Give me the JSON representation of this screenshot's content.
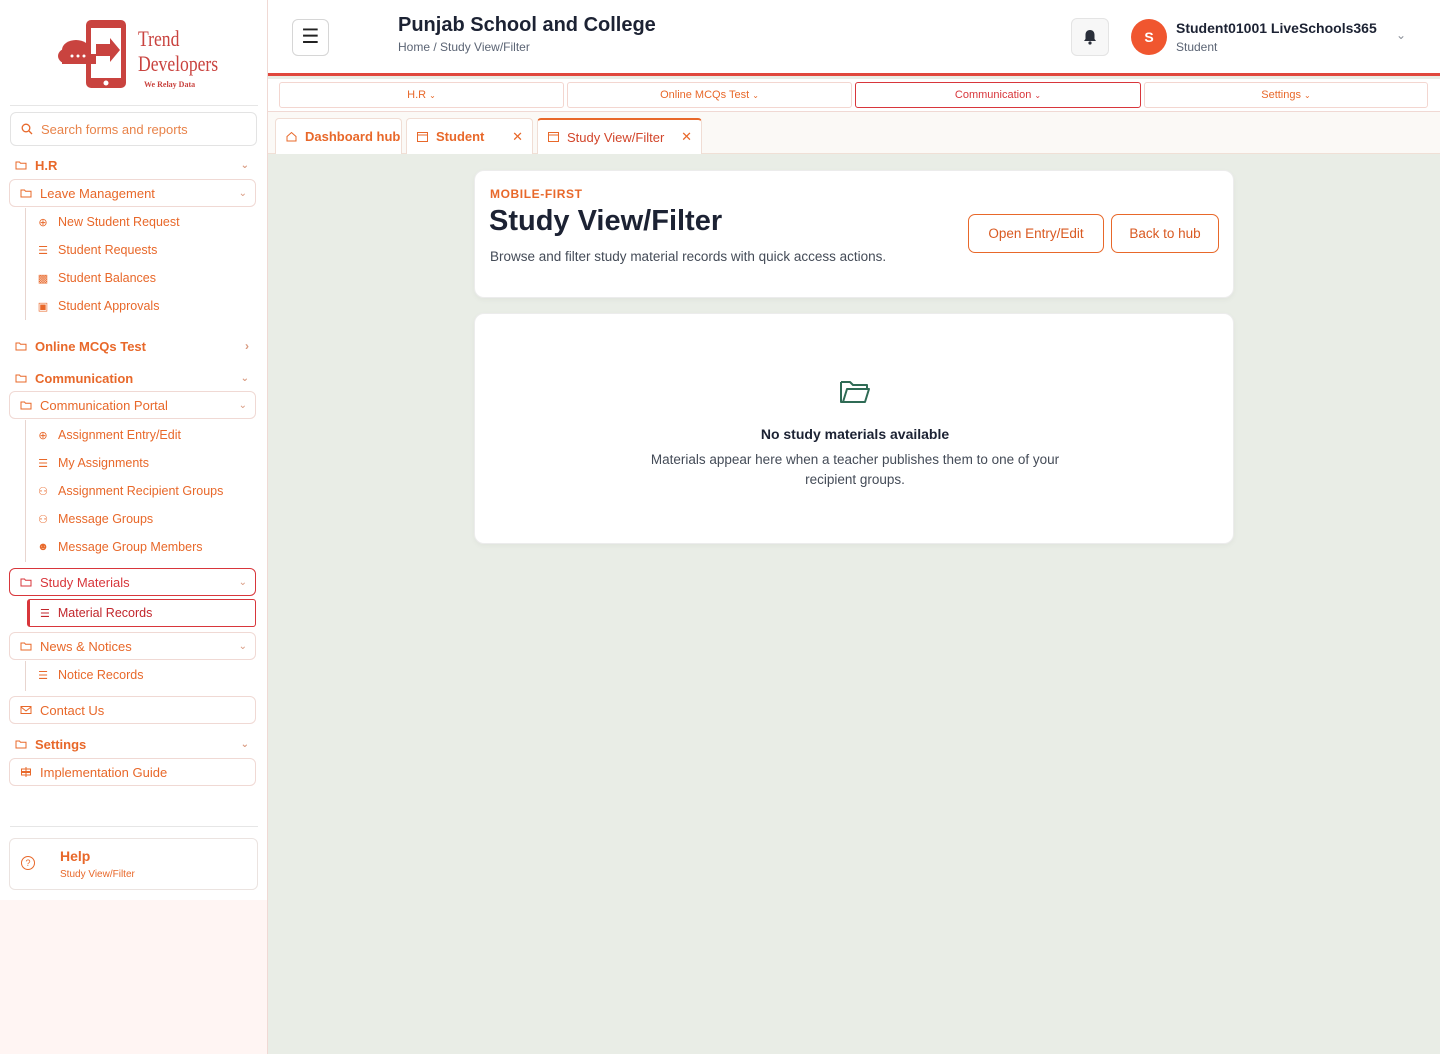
{
  "brand": {
    "line1": "Trend",
    "line2": "Developers",
    "tagline": "We Relay Data"
  },
  "search": {
    "placeholder": "Search forms and reports"
  },
  "sidebar": {
    "hr": "H.R",
    "leave_management": "Leave Management",
    "leave_items": [
      "New Student Request",
      "Student Requests",
      "Student Balances",
      "Student Approvals"
    ],
    "online_mcqs": "Online MCQs Test",
    "communication": "Communication",
    "communication_portal": "Communication Portal",
    "portal_items": [
      "Assignment Entry/Edit",
      "My Assignments",
      "Assignment Recipient Groups",
      "Message Groups",
      "Message Group Members"
    ],
    "study_materials": "Study Materials",
    "material_records": "Material Records",
    "news_notices": "News & Notices",
    "notice_records": "Notice Records",
    "contact_us": "Contact Us",
    "settings": "Settings",
    "implementation_guide": "Implementation Guide"
  },
  "help": {
    "title": "Help",
    "subtitle": "Study View/Filter"
  },
  "header": {
    "school": "Punjab School and College",
    "breadcrumb": "Home / Study View/Filter",
    "user_initial": "S",
    "user_name": "Student01001 LiveSchools365",
    "user_role": "Student"
  },
  "topmenu": [
    "H.R",
    "Online MCQs Test",
    "Communication",
    "Settings"
  ],
  "tabs": [
    "Dashboard hub",
    "Student",
    "Study View/Filter"
  ],
  "page": {
    "eyebrow": "MOBILE-FIRST",
    "title": "Study View/Filter",
    "description": "Browse and filter study material records with quick access actions.",
    "btn_open": "Open Entry/Edit",
    "btn_back": "Back to hub"
  },
  "empty": {
    "title": "No study materials available",
    "description": "Materials appear here when a teacher publishes them to one of your recipient groups."
  },
  "colors": {
    "accent": "#e8682a",
    "active": "#d8363b",
    "avatar": "#f0562f",
    "folder": "#2f6b55"
  }
}
